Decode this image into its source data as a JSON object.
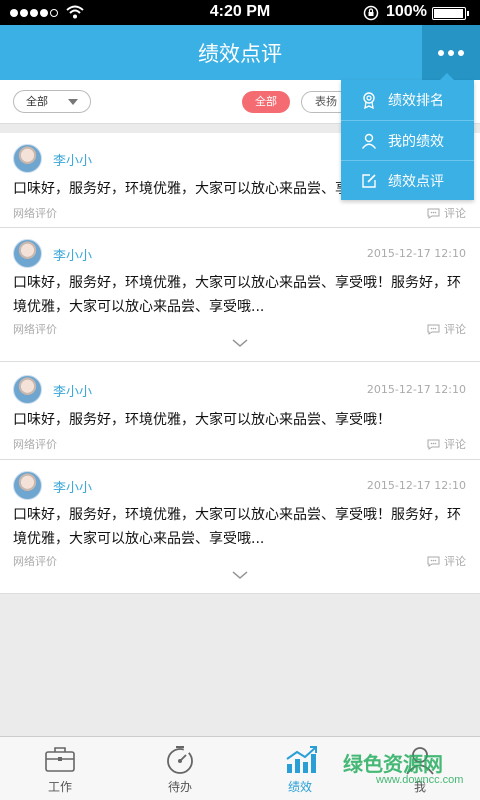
{
  "status_bar": {
    "time": "4:20 PM",
    "battery": "100%"
  },
  "header": {
    "title": "绩效点评"
  },
  "filter": {
    "select_value": "全部",
    "chip_all": "全部",
    "chip_praise": "表扬"
  },
  "menu": [
    {
      "label": "绩效排名",
      "icon": "award-icon"
    },
    {
      "label": "我的绩效",
      "icon": "user-icon"
    },
    {
      "label": "绩效点评",
      "icon": "edit-icon"
    }
  ],
  "reviews": [
    {
      "name": "李小小",
      "date": "",
      "content": "口味好，服务好，环境优雅，大家可以放心来品尝、享受哦！",
      "source": "网络评价",
      "comment": "评论"
    },
    {
      "name": "李小小",
      "date": "2015-12-17 12:10",
      "content": "口味好，服务好，环境优雅，大家可以放心来品尝、享受哦！服务好，环境优雅，大家可以放心来品尝、享受哦...",
      "source": "网络评价",
      "comment": "评论"
    },
    {
      "name": "李小小",
      "date": "2015-12-17 12:10",
      "content": "口味好，服务好，环境优雅，大家可以放心来品尝、享受哦！",
      "source": "网络评价",
      "comment": "评论"
    },
    {
      "name": "李小小",
      "date": "2015-12-17 12:10",
      "content": "口味好，服务好，环境优雅，大家可以放心来品尝、享受哦！服务好，环境优雅，大家可以放心来品尝、享受哦...",
      "source": "网络评价",
      "comment": "评论"
    }
  ],
  "tabs": [
    {
      "label": "工作",
      "icon": "briefcase-icon"
    },
    {
      "label": "待办",
      "icon": "stopwatch-icon"
    },
    {
      "label": "绩效",
      "icon": "bar-chart-icon",
      "active": true
    },
    {
      "label": "我",
      "icon": "person-icon"
    }
  ],
  "watermark": {
    "text": "绿色资源网",
    "url_text": "www.downcc.com"
  },
  "colors": {
    "primary": "#3bb0e4",
    "primary_dark": "#2694c5",
    "accent_red": "#f46c72",
    "name_blue": "#3aa6d8"
  }
}
